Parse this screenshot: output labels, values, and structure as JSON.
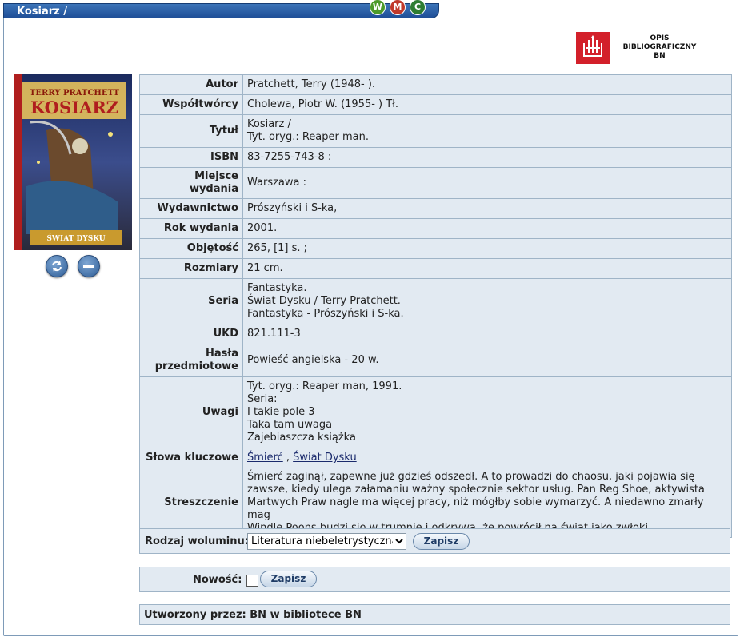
{
  "window": {
    "title": "Kosiarz /"
  },
  "view_modes": [
    "W",
    "M",
    "C"
  ],
  "colors": {
    "w": "#4c9a2a",
    "m": "#c0392b",
    "c": "#2e7d32",
    "accent": "#1f4f97"
  },
  "logo": {
    "text": "OPIS BIBLIOGRAFICZNY BN"
  },
  "cover": {
    "author": "TERRY PRATCHETT",
    "title": "KOSIARZ",
    "series": "ŚWIAT DYSKU"
  },
  "cover_actions": {
    "rotate_icon": "refresh-icon",
    "remove_icon": "minus-icon"
  },
  "record": [
    {
      "label": "Autor",
      "lines": [
        "Pratchett, Terry (1948- )."
      ]
    },
    {
      "label": "Współtwórcy",
      "lines": [
        "Cholewa, Piotr W. (1955- ) Tł."
      ]
    },
    {
      "label": "Tytuł",
      "lines": [
        "Kosiarz /",
        "Tyt. oryg.: Reaper man."
      ]
    },
    {
      "label": "ISBN",
      "lines": [
        "83-7255-743-8 :"
      ]
    },
    {
      "label": "Miejsce wydania",
      "lines": [
        "Warszawa :"
      ]
    },
    {
      "label": "Wydawnictwo",
      "lines": [
        "Prószyński i S-ka,"
      ]
    },
    {
      "label": "Rok wydania",
      "lines": [
        "2001."
      ]
    },
    {
      "label": "Objętość",
      "lines": [
        "265, [1] s. ;"
      ]
    },
    {
      "label": "Rozmiary",
      "lines": [
        "21 cm."
      ]
    },
    {
      "label": "Seria",
      "lines": [
        "Fantastyka.",
        "Świat Dysku / Terry Pratchett.",
        "Fantastyka - Prószyński i S-ka."
      ]
    },
    {
      "label": "UKD",
      "lines": [
        "821.111-3"
      ]
    },
    {
      "label": "Hasła przedmiotowe",
      "lines": [
        "Powieść angielska - 20 w."
      ]
    },
    {
      "label": "Uwagi",
      "lines": [
        "Tyt. oryg.: Reaper man, 1991.",
        "Seria:",
        "I takie pole 3",
        "Taka tam uwaga",
        "Zajebiaszcza książka"
      ]
    }
  ],
  "keywords": {
    "label": "Słowa kluczowe",
    "items": [
      "Śmierć",
      "Świat Dysku"
    ],
    "separator": " , "
  },
  "summary": {
    "label": "Streszczenie",
    "lines": [
      "Śmierć zaginął, zapewne już gdzieś odszedł. A to prowadzi do chaosu, jaki pojawia się",
      "zawsze, kiedy ulega załamaniu ważny społecznie sektor usług. Pan Reg Shoe, aktywista",
      "Martwych Praw nagle ma więcej pracy, niż mógłby sobie wymarzyć. A niedawno zmarły mag",
      "Windle Poons budzi się w trumnie i odkrywa, że powrócił na świat jako zwłoki."
    ]
  },
  "volume_type": {
    "label": "Rodzaj woluminu:",
    "selected": "Literatura niebeletrystyczna",
    "save": "Zapisz"
  },
  "novelty": {
    "label": "Nowość:",
    "save": "Zapisz"
  },
  "created_by": {
    "text": "Utworzony przez: BN w bibliotece BN"
  }
}
